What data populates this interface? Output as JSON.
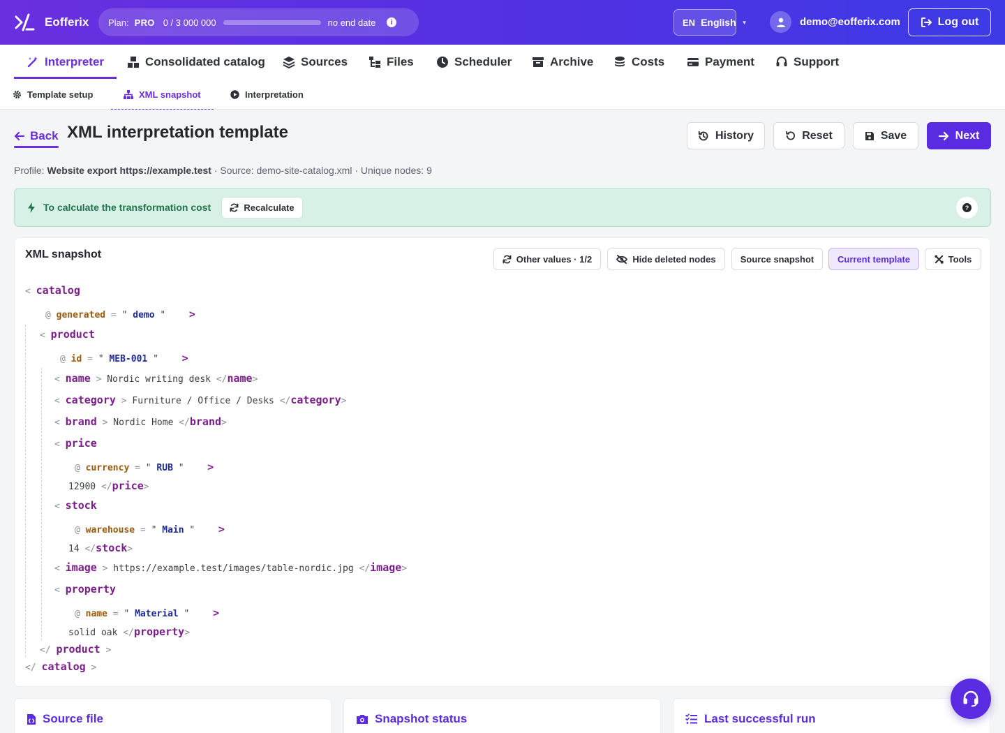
{
  "app": {
    "name": "Eofferix"
  },
  "plan": {
    "label": "Plan:",
    "tier": "PRO",
    "usage": "0 / 3 000 000",
    "usage_fraction": 0.0,
    "end_date": "no end date"
  },
  "language": {
    "code": "EN",
    "name": "English"
  },
  "user": {
    "email": "demo@eofferix.com"
  },
  "logout_label": "Log out",
  "main_nav": [
    {
      "label": "Interpreter",
      "icon": "magic-wand-icon",
      "active": true
    },
    {
      "label": "Consolidated catalog",
      "icon": "boxes-icon"
    },
    {
      "label": "Sources",
      "icon": "layers-icon"
    },
    {
      "label": "Files",
      "icon": "file-tree-icon"
    },
    {
      "label": "Scheduler",
      "icon": "clock-icon"
    },
    {
      "label": "Archive",
      "icon": "archive-icon"
    },
    {
      "label": "Costs",
      "icon": "coins-icon"
    },
    {
      "label": "Payment",
      "icon": "credit-card-icon"
    },
    {
      "label": "Support",
      "icon": "headset-icon"
    }
  ],
  "sub_nav": [
    {
      "label": "Template setup",
      "icon": "gear-icon"
    },
    {
      "label": "XML snapshot",
      "icon": "sitemap-icon",
      "active": true
    },
    {
      "label": "Interpretation",
      "icon": "play-circle-icon"
    }
  ],
  "header": {
    "back_label": "Back",
    "title": "XML interpretation template",
    "history_label": "History",
    "reset_label": "Reset",
    "save_label": "Save",
    "next_label": "Next"
  },
  "meta": {
    "profile_label": "Profile:",
    "profile_value": "Website export https://example.test",
    "source_text": "· Source: demo-site-catalog.xml · Unique nodes: 9"
  },
  "alert": {
    "text": "To calculate the transformation cost",
    "button_label": "Recalculate",
    "color": "#d8f1e6"
  },
  "snapshot": {
    "title": "XML snapshot",
    "tools": {
      "other_values": "Other values · 1/2",
      "hide_deleted": "Hide deleted nodes",
      "source_snapshot": "Source snapshot",
      "current_template": "Current template",
      "tools": "Tools"
    },
    "xml": {
      "root_tag": "catalog",
      "root_attr_name": "generated",
      "root_attr_value": "demo",
      "product_tag": "product",
      "product_attr_name": "id",
      "product_attr_value": "MEB-001",
      "name_tag": "name",
      "name_text": "Nordic writing desk",
      "category_tag": "category",
      "category_text": "Furniture / Office / Desks",
      "brand_tag": "brand",
      "brand_text": "Nordic Home",
      "price_tag": "price",
      "price_attr_name": "currency",
      "price_attr_value": "RUB",
      "price_text": "12900",
      "stock_tag": "stock",
      "stock_attr_name": "warehouse",
      "stock_attr_value": "Main",
      "stock_text": "14",
      "image_tag": "image",
      "image_text": "https://example.test/images/table-nordic.jpg",
      "property_tag": "property",
      "property_attr_name": "name",
      "property_attr_value": "Material",
      "property_text": "solid oak"
    }
  },
  "cards": [
    {
      "title": "Source file",
      "icon": "file-code-icon"
    },
    {
      "title": "Snapshot status",
      "icon": "camera-icon"
    },
    {
      "title": "Last successful run",
      "icon": "checklist-icon"
    }
  ],
  "colors": {
    "accent": "#5a2be0",
    "tag": "#7a1f8a",
    "attr": "#9a5a0c",
    "value": "#1c2a96"
  }
}
